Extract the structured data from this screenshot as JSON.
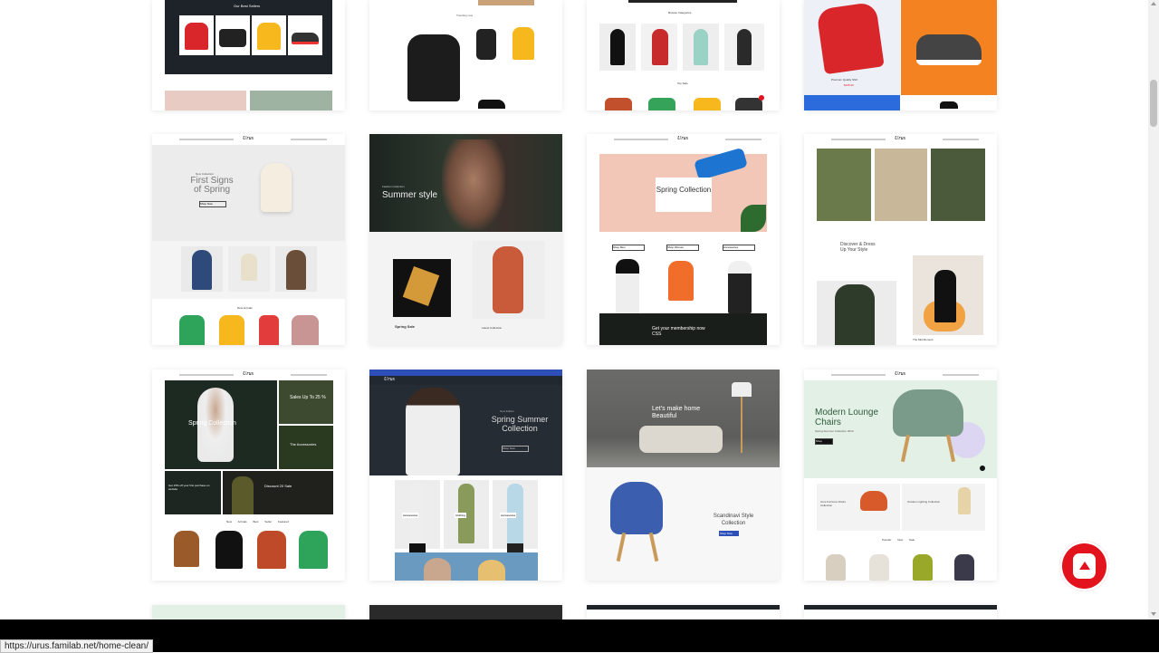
{
  "status_url": "https://urus.familab.net/home-clean/",
  "brand_logo": "Urus",
  "tiles": {
    "r0c0": {
      "heading": "Our Best Sellers"
    },
    "r0c1": {
      "heading": "Trending now"
    },
    "r0c2": {
      "heading": "Browse Categories",
      "sub": "Top Sale"
    },
    "r0c3": {
      "caption": "Premium Quality Shirt",
      "price": "$125.00"
    },
    "r1c0": {
      "eyebrow": "New Collection",
      "title": "First Signs of Spring",
      "button": "Shop Now",
      "section": "New Arrivals"
    },
    "r1c1": {
      "eyebrow": "Fashion Collection",
      "title": "Summer style",
      "promo": "Spring Sale",
      "promo2": "Latest Collection"
    },
    "r1c2": {
      "title": "Spring Collection",
      "b1": "Shop Men",
      "b2": "Shop Women",
      "b3": "Accessories",
      "banner": "Get your membership now CSS"
    },
    "r1c3": {
      "side_text": "Discover & Dress Up Your Style",
      "caption": "The Mid Moment"
    },
    "r2c0": {
      "title": "Spring Collection",
      "side1": "Sales Up To 25 %",
      "side2": "The Accessories",
      "promo1": "Get 15% off your first purchase on website",
      "promo2": "Discount 20 Sale",
      "tabs": [
        "New Arrivals",
        "Best Seller",
        "Featured"
      ]
    },
    "r2c1": {
      "eyebrow": "New Edition",
      "title": "Spring Summer Collection",
      "button": "Shop Now",
      "cats": [
        "Accessories",
        "Clothing",
        "Accessories"
      ]
    },
    "r2c2": {
      "title": "Let's make home Beautiful",
      "title2": "Scandinavi Style Collection",
      "button": "Shop Now"
    },
    "r2c3": {
      "title": "Modern Lounge Chairs",
      "sub": "Spring-Summer Collection 2019",
      "button": "Shop",
      "card1": "Urus Furnture Chairs Collection",
      "card2": "Outdoor Lighting Collection",
      "tabs": [
        "Popular",
        "New",
        "Sale"
      ]
    }
  },
  "colors": {
    "accent": "#e2131c",
    "blue_header": "#2d4fb7",
    "furn_green": "#e3f0e6"
  }
}
